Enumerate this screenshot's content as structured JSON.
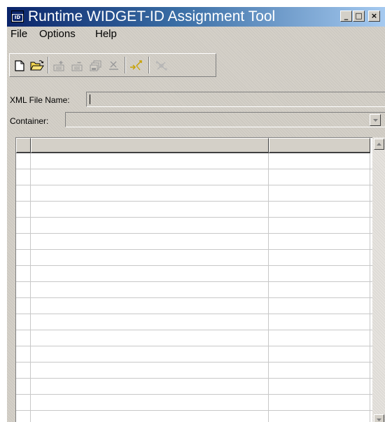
{
  "window": {
    "title": "Runtime WIDGET-ID Assignment Tool",
    "app_icon_text": "ID",
    "minimize_glyph": "_",
    "maximize_glyph": "□",
    "close_glyph": "×"
  },
  "menu": {
    "items": [
      {
        "label": "File"
      },
      {
        "label": "Options"
      },
      {
        "label": "Help"
      }
    ]
  },
  "toolbar": {
    "buttons": [
      {
        "icon": "new-document-icon",
        "enabled": true
      },
      {
        "icon": "open-folder-icon",
        "enabled": true
      },
      {
        "icon": "add-widget-icon",
        "enabled": false
      },
      {
        "icon": "remove-widget-icon",
        "enabled": false
      },
      {
        "icon": "save-stack-icon",
        "enabled": false
      },
      {
        "icon": "delete-icon",
        "enabled": false
      },
      {
        "icon": "assign-id-icon",
        "enabled": false
      },
      {
        "icon": "clear-ids-icon",
        "enabled": false
      }
    ]
  },
  "form": {
    "xml_file_label": "XML File Name:",
    "xml_file_value": "",
    "container_label": "Container:",
    "container_value": ""
  },
  "table": {
    "columns": [
      "",
      "",
      ""
    ],
    "row_count": 17
  },
  "colors": {
    "title_gradient_start": "#0a246a",
    "title_gradient_end": "#a6caf0",
    "face": "#d4d0c8"
  }
}
